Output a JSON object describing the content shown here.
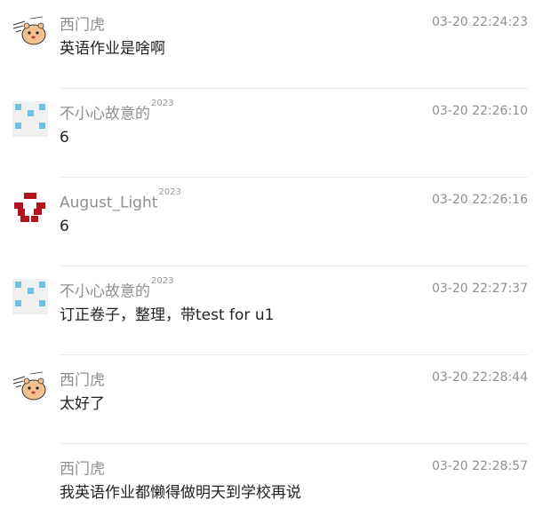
{
  "colors": {
    "username": "#8f8f8f",
    "timestamp": "#8f8f8f",
    "text": "#222222",
    "divider": "#ececec",
    "avatar_blue": "#6ec1e4",
    "avatar_red": "#b5121b"
  },
  "messages": [
    {
      "username": "西门虎",
      "badge": "",
      "time": "03-20 22:24:23",
      "text": "英语作业是啥啊",
      "avatar": "cartoon-hamster-avatar"
    },
    {
      "username": "不小心故意的",
      "badge": "2023",
      "time": "03-20 22:26:10",
      "text": "6",
      "avatar": "blue-pixel-identicon"
    },
    {
      "username": "August_Light",
      "badge": "2023",
      "time": "03-20 22:26:16",
      "text": "6",
      "avatar": "red-pixel-identicon"
    },
    {
      "username": "不小心故意的",
      "badge": "2023",
      "time": "03-20 22:27:37",
      "text": "订正卷子，整理，带test for u1",
      "avatar": "blue-pixel-identicon"
    },
    {
      "username": "西门虎",
      "badge": "",
      "time": "03-20 22:28:44",
      "text": "太好了",
      "avatar": "cartoon-hamster-avatar"
    },
    {
      "username": "西门虎",
      "badge": "",
      "time": "03-20 22:28:57",
      "text": "我英语作业都懒得做明天到学校再说",
      "avatar": ""
    }
  ]
}
